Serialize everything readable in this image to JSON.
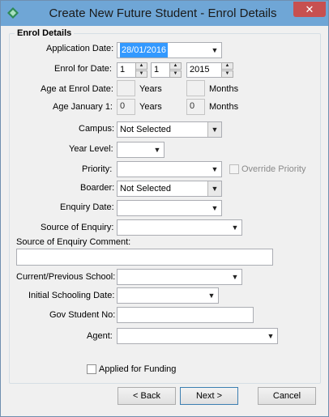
{
  "window": {
    "title": "Create New Future Student - Enrol Details",
    "close_glyph": "✕"
  },
  "group": {
    "title": "Enrol Details"
  },
  "labels": {
    "application_date": "Application Date:",
    "enrol_for_date": "Enrol for Date:",
    "age_at_enrol": "Age at Enrol Date:",
    "age_jan1": "Age January 1:",
    "years": "Years",
    "months": "Months",
    "campus": "Campus:",
    "year_level": "Year Level:",
    "priority": "Priority:",
    "override_priority": "Override Priority",
    "boarder": "Boarder:",
    "enquiry_date": "Enquiry Date:",
    "source_of_enquiry": "Source of Enquiry:",
    "source_comment": "Source of Enquiry Comment:",
    "current_school": "Current/Previous School:",
    "initial_schooling_date": "Initial Schooling Date:",
    "gov_student_no": "Gov Student No:",
    "agent": "Agent:",
    "applied_for_funding": "Applied for Funding"
  },
  "values": {
    "application_date": "28/01/2016",
    "enrol_day": "1",
    "enrol_month": "1",
    "enrol_year": "2015",
    "age_enrol_years": "",
    "age_enrol_months": "",
    "age_jan1_years": "0",
    "age_jan1_months": "0",
    "campus": "Not Selected",
    "year_level": "",
    "priority": "",
    "boarder": "Not Selected",
    "enquiry_date": "",
    "source_of_enquiry": "",
    "source_comment": "",
    "current_school": "",
    "initial_schooling_date": "",
    "gov_student_no": "",
    "agent": ""
  },
  "checkboxes": {
    "override_priority": false,
    "applied_for_funding": false
  },
  "buttons": {
    "back": "< Back",
    "next": "Next >",
    "cancel": "Cancel"
  },
  "icons": {
    "dropdown": "▼",
    "spin_up": "▲",
    "spin_down": "▼"
  },
  "colors": {
    "titlebar": "#6fa6d6",
    "close": "#c75050",
    "selection": "#3399ff"
  }
}
